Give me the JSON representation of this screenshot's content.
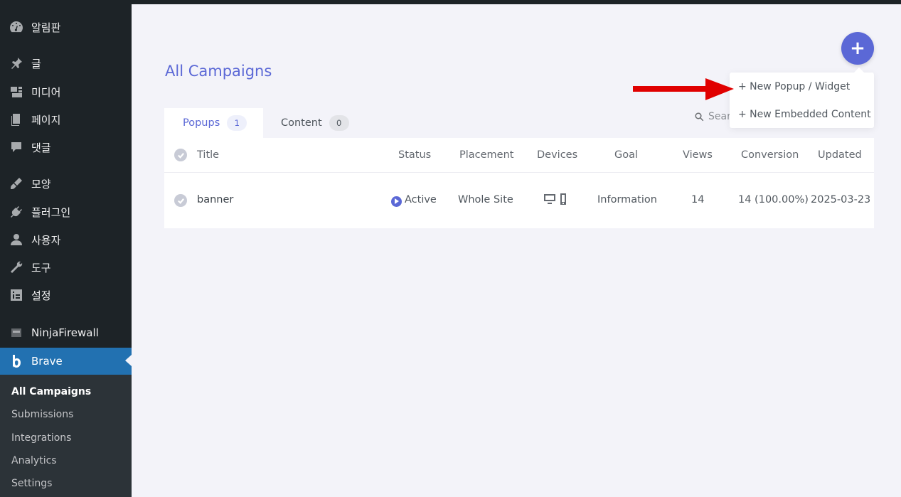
{
  "sidebar": {
    "items": [
      {
        "label": "알림판",
        "icon": "dashboard-icon"
      },
      {
        "label": "글",
        "icon": "pin-icon"
      },
      {
        "label": "미디어",
        "icon": "media-icon"
      },
      {
        "label": "페이지",
        "icon": "pages-icon"
      },
      {
        "label": "댓글",
        "icon": "comments-icon"
      },
      {
        "label": "모양",
        "icon": "appearance-icon"
      },
      {
        "label": "플러그인",
        "icon": "plugins-icon"
      },
      {
        "label": "사용자",
        "icon": "users-icon"
      },
      {
        "label": "도구",
        "icon": "wrench-icon"
      },
      {
        "label": "설정",
        "icon": "settings-icon"
      },
      {
        "label": "NinjaFirewall",
        "icon": "ninja-icon"
      },
      {
        "label": "Brave",
        "icon": "brave-icon"
      }
    ],
    "submenu": [
      "All Campaigns",
      "Submissions",
      "Integrations",
      "Analytics",
      "Settings"
    ]
  },
  "main": {
    "title": "All Campaigns",
    "add_button": "+",
    "tabs": [
      {
        "label": "Popups",
        "count": "1"
      },
      {
        "label": "Content",
        "count": "0"
      }
    ],
    "search_placeholder": "Searc",
    "table": {
      "columns": [
        "Title",
        "Status",
        "Placement",
        "Devices",
        "Goal",
        "Views",
        "Conversion",
        "Updated"
      ],
      "rows": [
        {
          "title": "banner",
          "status": "Active",
          "placement": "Whole Site",
          "devices": [
            "desktop-icon",
            "mobile-icon"
          ],
          "goal": "Information",
          "views": "14",
          "conversion": "14 (100.00%)",
          "updated": "2025-03-23"
        }
      ]
    },
    "dropdown": [
      "+ New Popup / Widget",
      "+ New Embedded Content"
    ]
  },
  "colors": {
    "accent": "#5b68d6",
    "sidebar_bg": "#1d2327",
    "sidebar_active": "#2271b1",
    "arrow": "#e00000"
  }
}
